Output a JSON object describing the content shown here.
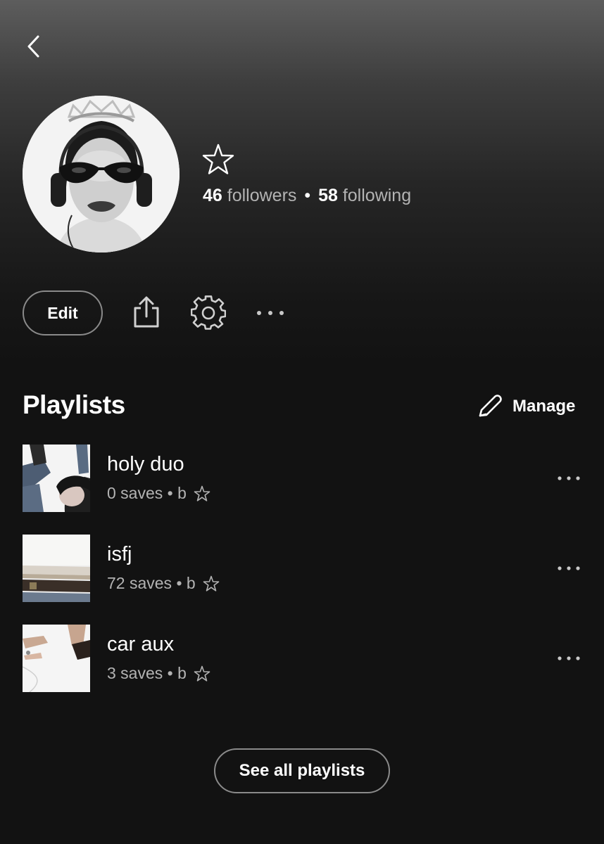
{
  "header": {
    "back_icon": "chevron-left-icon"
  },
  "profile": {
    "avatar": "profile-photo",
    "name_icon": "star-icon",
    "followers_count": "46",
    "followers_label": " followers",
    "separator": "•",
    "following_count": "58",
    "following_label": " following"
  },
  "actions": {
    "edit_label": "Edit",
    "share_icon": "share-icon",
    "settings_icon": "gear-icon",
    "more_icon": "more-horizontal-icon"
  },
  "playlists_section": {
    "title": "Playlists",
    "manage_label": "Manage",
    "manage_icon": "pencil-icon",
    "items": [
      {
        "title": "holy duo",
        "meta": "0 saves • b",
        "icon": "star-icon"
      },
      {
        "title": "isfj",
        "meta": "72 saves • b",
        "icon": "star-icon"
      },
      {
        "title": "car aux",
        "meta": "3 saves • b",
        "icon": "star-icon"
      }
    ],
    "see_all_label": "See all playlists"
  },
  "colors": {
    "background": "#121212",
    "text_primary": "#ffffff",
    "text_secondary": "#b3b3b3",
    "border": "#8a8a8a"
  }
}
